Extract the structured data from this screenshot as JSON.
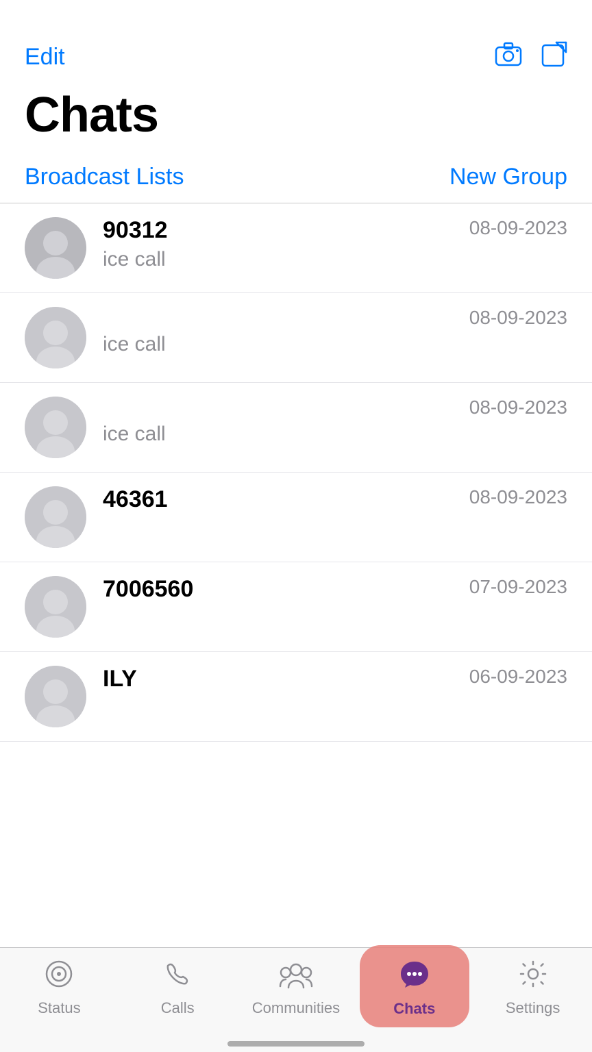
{
  "header": {
    "edit_label": "Edit",
    "title": "Chats",
    "camera_icon": "camera",
    "compose_icon": "compose"
  },
  "actions": {
    "broadcast_label": "Broadcast Lists",
    "new_group_label": "New Group"
  },
  "chats": [
    {
      "id": 1,
      "name": "90312",
      "message": "ice call",
      "time": "08-09-2023",
      "bold_name": true,
      "has_avatar": true,
      "avatar_color": "#B0B0B5"
    },
    {
      "id": 2,
      "name": "",
      "message": "ice call",
      "time": "08-09-2023",
      "bold_name": false,
      "has_avatar": true,
      "avatar_color": "#C7C7CC"
    },
    {
      "id": 3,
      "name": "",
      "message": "ice call",
      "time": "08-09-2023",
      "bold_name": false,
      "has_avatar": true,
      "avatar_color": "#C7C7CC"
    },
    {
      "id": 4,
      "name": "46361",
      "message": "",
      "time": "08-09-2023",
      "bold_name": true,
      "has_avatar": true,
      "avatar_color": "#C7C7CC"
    },
    {
      "id": 5,
      "name": "7006560",
      "message": "",
      "time": "07-09-2023",
      "bold_name": true,
      "has_avatar": true,
      "avatar_color": "#C7C7CC"
    },
    {
      "id": 6,
      "name": "ILY",
      "message": "",
      "time": "06-09-2023",
      "bold_name": true,
      "has_avatar": true,
      "avatar_color": "#C7C7CC"
    }
  ],
  "tabs": [
    {
      "id": "status",
      "label": "Status",
      "icon": "status",
      "active": false
    },
    {
      "id": "calls",
      "label": "Calls",
      "icon": "calls",
      "active": false
    },
    {
      "id": "communities",
      "label": "Communities",
      "icon": "communities",
      "active": false
    },
    {
      "id": "chats",
      "label": "Chats",
      "icon": "chats",
      "active": true
    },
    {
      "id": "settings",
      "label": "Settings",
      "icon": "settings",
      "active": false
    }
  ]
}
